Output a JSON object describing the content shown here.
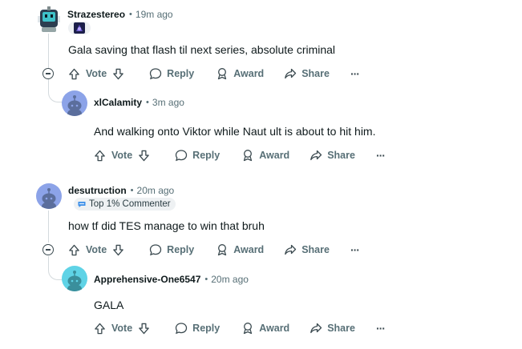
{
  "comments": [
    {
      "user": "Strazestereo",
      "separator": "•",
      "time": "19m ago",
      "text": "Gala saving that flash til next series, absolute criminal",
      "actions": {
        "vote": "Vote",
        "reply": "Reply",
        "award": "Award",
        "share": "Share",
        "more": "···"
      }
    },
    {
      "user": "xlCalamity",
      "separator": "•",
      "time": "3m ago",
      "text": "And walking onto Viktor while Naut ult is about to hit him.",
      "actions": {
        "vote": "Vote",
        "reply": "Reply",
        "award": "Award",
        "share": "Share",
        "more": "···"
      }
    },
    {
      "user": "desutruction",
      "separator": "•",
      "time": "20m ago",
      "flair": "Top 1% Commenter",
      "text": "how tf did TES manage to win that bruh",
      "actions": {
        "vote": "Vote",
        "reply": "Reply",
        "award": "Award",
        "share": "Share",
        "more": "···"
      }
    },
    {
      "user": "Apprehensive-One6547",
      "separator": "•",
      "time": "20m ago",
      "text": "GALA",
      "actions": {
        "vote": "Vote",
        "reply": "Reply",
        "award": "Award",
        "share": "Share",
        "more": "···"
      }
    }
  ],
  "colors": {
    "snoo_blue": "#8ca3e8",
    "snoo_cyan": "#5fd3e6",
    "meta_gray": "#576f76",
    "thread_line": "#d4dadd"
  }
}
